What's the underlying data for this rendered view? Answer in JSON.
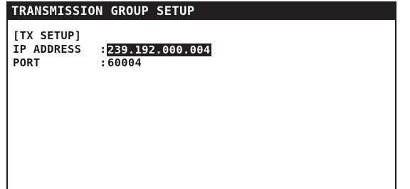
{
  "title": "TRANSMISSION GROUP SETUP",
  "section_heading": "[TX SETUP]",
  "fields": [
    {
      "label": "IP ADDRESS",
      "separator": ":",
      "value": "239.192.000.004",
      "selected": true
    },
    {
      "label": "PORT",
      "separator": ":",
      "value": "60004",
      "selected": false
    }
  ],
  "colors": {
    "title_bg": "#231f20",
    "title_fg": "#ffffff",
    "text": "#1a1a1a",
    "highlight_bg": "#231f20",
    "highlight_fg": "#ffffff"
  }
}
